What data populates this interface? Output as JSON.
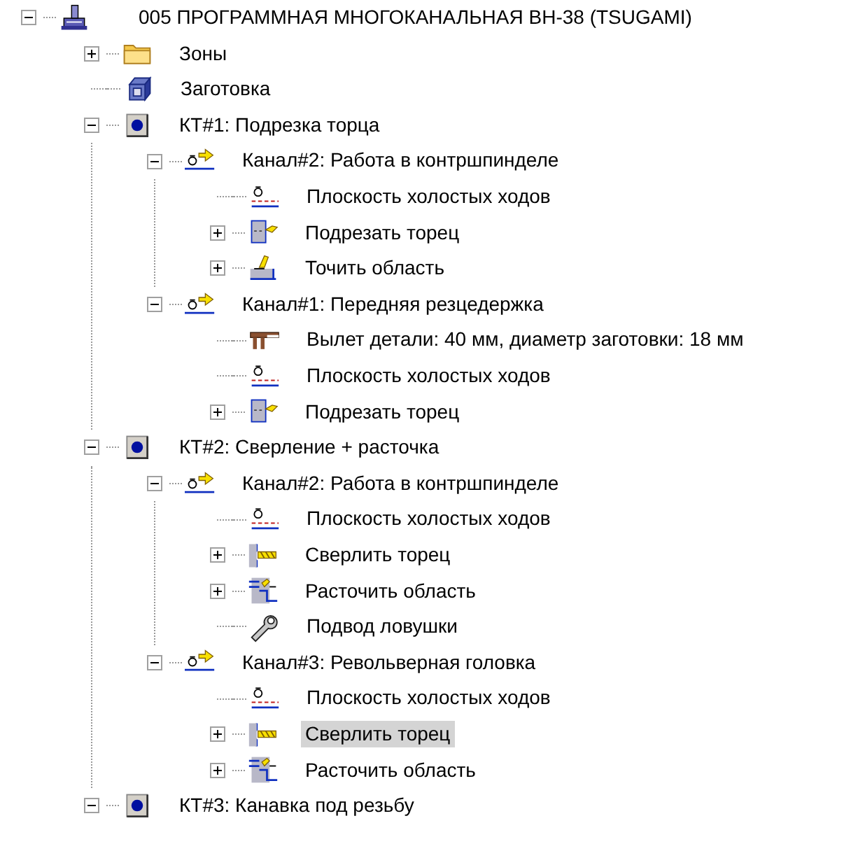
{
  "tree": [
    {
      "label": "005  ПРОГРАММНАЯ МНОГОКАНАЛЬНАЯ ВН-38 (TSUGAMI)",
      "kind": "machine",
      "expanded": true,
      "selected": false,
      "children": [
        {
          "label": "Зоны",
          "kind": "folder",
          "expanded": false,
          "selected": false
        },
        {
          "label": "Заготовка",
          "kind": "blank",
          "selected": false
        },
        {
          "label": "КТ#1: Подрезка торца",
          "kind": "position",
          "expanded": true,
          "selected": false,
          "children": [
            {
              "label": "Канал#2: Работа в контршпинделе",
              "kind": "channel",
              "expanded": true,
              "selected": false,
              "children": [
                {
                  "label": "Плоскость холостых ходов",
                  "kind": "plane",
                  "selected": false
                },
                {
                  "label": "Подрезать торец",
                  "kind": "facing",
                  "expanded": false,
                  "selected": false
                },
                {
                  "label": "Точить область",
                  "kind": "turning",
                  "expanded": false,
                  "selected": false
                }
              ]
            },
            {
              "label": "Канал#1: Передняя резцедержка",
              "kind": "channel",
              "expanded": true,
              "selected": false,
              "children": [
                {
                  "label": "Вылет детали: 40 мм, диаметр заготовки: 18 мм",
                  "kind": "offset",
                  "selected": false
                },
                {
                  "label": "Плоскость холостых ходов",
                  "kind": "plane",
                  "selected": false
                },
                {
                  "label": "Подрезать торец",
                  "kind": "facing",
                  "expanded": false,
                  "selected": false
                }
              ]
            }
          ]
        },
        {
          "label": "КТ#2: Сверление + расточка",
          "kind": "position",
          "expanded": true,
          "selected": false,
          "children": [
            {
              "label": "Канал#2: Работа в контршпинделе",
              "kind": "channel",
              "expanded": true,
              "selected": false,
              "children": [
                {
                  "label": "Плоскость холостых ходов",
                  "kind": "plane",
                  "selected": false
                },
                {
                  "label": "Сверлить торец",
                  "kind": "drilling",
                  "expanded": false,
                  "selected": false
                },
                {
                  "label": "Расточить область",
                  "kind": "boring",
                  "expanded": false,
                  "selected": false
                },
                {
                  "label": "Подвод ловушки",
                  "kind": "wrench",
                  "selected": false
                }
              ]
            },
            {
              "label": "Канал#3: Револьверная головка",
              "kind": "channel",
              "expanded": true,
              "selected": false,
              "children": [
                {
                  "label": "Плоскость холостых ходов",
                  "kind": "plane",
                  "selected": false
                },
                {
                  "label": "Сверлить торец",
                  "kind": "drilling",
                  "expanded": false,
                  "selected": true
                },
                {
                  "label": "Расточить область",
                  "kind": "boring",
                  "expanded": false,
                  "selected": false
                }
              ]
            }
          ]
        },
        {
          "label": "КТ#3: Канавка под резьбу",
          "kind": "position",
          "expanded": true,
          "selected": false
        }
      ]
    }
  ]
}
